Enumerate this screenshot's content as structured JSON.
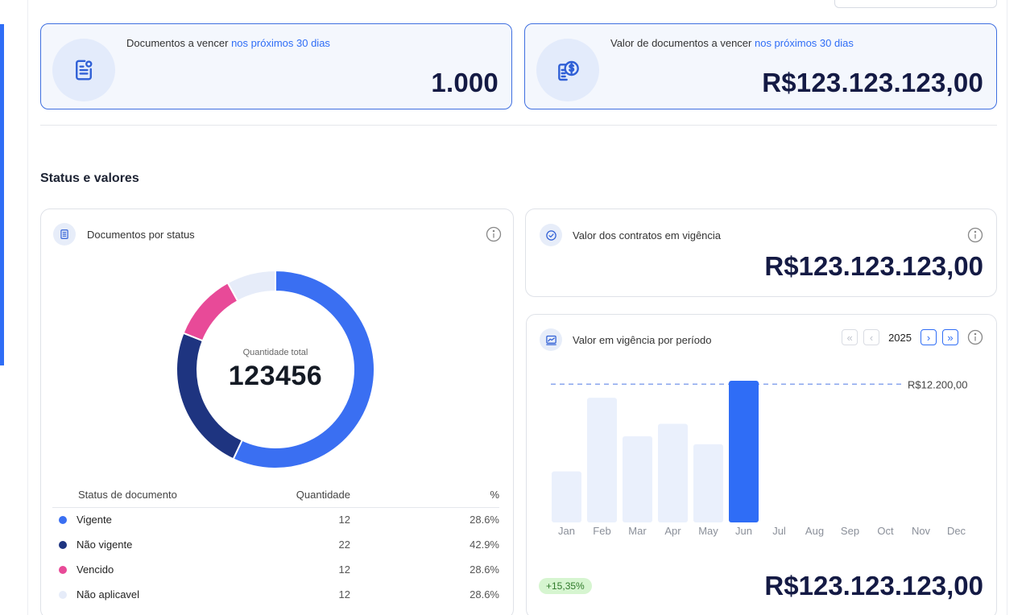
{
  "kpis": [
    {
      "label_prefix": "Documentos a vencer ",
      "label_highlight": "nos próximos 30 dias",
      "value": "1.000",
      "icon": "document-icon"
    },
    {
      "label_prefix": "Valor de documentos a vencer ",
      "label_highlight": "nos próximos 30 dias",
      "value": "R$123.123.123,00",
      "icon": "money-document-icon"
    }
  ],
  "section": {
    "title": "Status e valores"
  },
  "status_card": {
    "title": "Documentos por status",
    "center_caption": "Quantidade total",
    "center_value": "123456",
    "table_headers": [
      "Status de documento",
      "Quantidade",
      "%"
    ],
    "rows": [
      {
        "label": "Vigente",
        "qty": "12",
        "pct": "28.6%",
        "color": "#3a6ff2"
      },
      {
        "label": "Não vigente",
        "qty": "22",
        "pct": "42.9%",
        "color": "#1e3480"
      },
      {
        "label": "Vencido",
        "qty": "12",
        "pct": "28.6%",
        "color": "#e84a98"
      },
      {
        "label": "Não aplicavel",
        "qty": "12",
        "pct": "28.6%",
        "color": "#e6ecf9"
      }
    ]
  },
  "contracts_card": {
    "title": "Valor dos contratos em vigência",
    "value": "R$123.123.123,00"
  },
  "period_card": {
    "title": "Valor em vigência por período",
    "year": "2025",
    "growth_badge": "+15,35%",
    "total_value": "R$123.123.123,00"
  },
  "chart_data": {
    "type": "bar",
    "categories": [
      "Jan",
      "Feb",
      "Mar",
      "Apr",
      "May",
      "Jun",
      "Jul",
      "Aug",
      "Sep",
      "Oct",
      "Nov",
      "Dec"
    ],
    "values": [
      4500,
      11000,
      7600,
      8700,
      6900,
      12500,
      null,
      null,
      null,
      null,
      null,
      null
    ],
    "highlight_index": 5,
    "reference_line": {
      "value": 12200,
      "label": "R$12.200,00"
    },
    "ylim": [
      0,
      13000
    ],
    "bar_color": "#eaf0fc",
    "highlight_color": "#2f6df6",
    "reference_color": "#8aa6ee"
  },
  "donut_data": {
    "type": "pie",
    "segments": [
      {
        "label": "Vigente",
        "value": 57,
        "color": "#3a6ff2"
      },
      {
        "label": "Não vigente",
        "value": 24,
        "color": "#1e3480"
      },
      {
        "label": "Vencido",
        "value": 11,
        "color": "#e84a98"
      },
      {
        "label": "Não aplicavel",
        "value": 8,
        "color": "#e6ecf9"
      }
    ]
  }
}
